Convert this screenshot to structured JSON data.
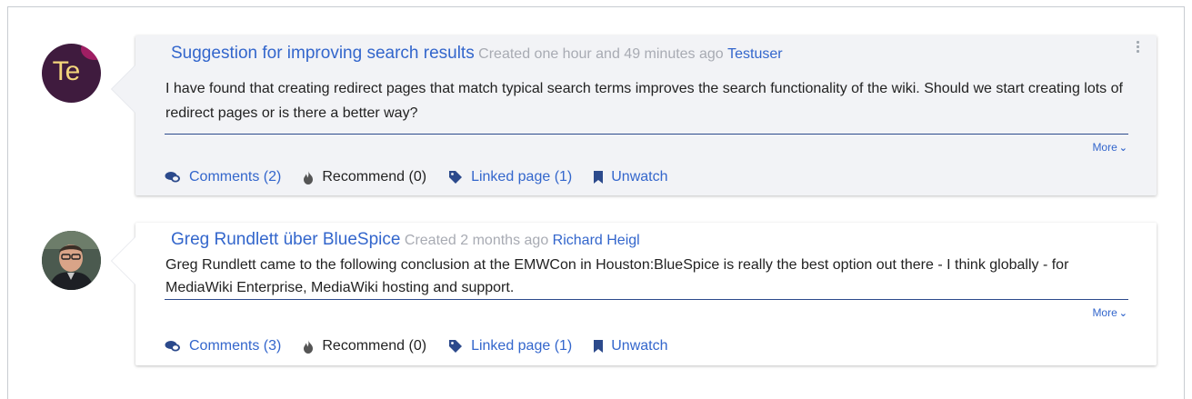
{
  "posts": [
    {
      "title": "Suggestion for improving search results",
      "created": "Created one hour and 49 minutes ago",
      "author": "Testuser",
      "avatar_text": "Te",
      "avatar_colors": {
        "bg": "#3f1b3e",
        "text": "#f3d57b",
        "accent": "#b01e6a"
      },
      "body": "I have found that creating redirect pages that match typical search terms improves the search functionality of the wiki. Should we start creating lots of redirect pages or is there a better way?",
      "more_label": "More",
      "comments_label": "Comments (2)",
      "recommend_label": "Recommend (0)",
      "linked_label": "Linked page (1)",
      "watch_label": "Unwatch"
    },
    {
      "title": "Greg Rundlett über BlueSpice",
      "created": "Created 2 months ago",
      "author": "Richard Heigl",
      "body": "Greg Rundlett came to the following conclusion at the EMWCon in Houston:BlueSpice is really the best option out there - I think globally - for MediaWiki Enterprise, MediaWiki hosting and support.",
      "more_label": "More",
      "comments_label": "Comments (3)",
      "recommend_label": "Recommend (0)",
      "linked_label": "Linked page (1)",
      "watch_label": "Unwatch"
    }
  ],
  "colors": {
    "link": "#3366cc",
    "meta": "#a8abb3",
    "divider": "#2c4a8c",
    "card_shaded": "#f2f3f6"
  }
}
